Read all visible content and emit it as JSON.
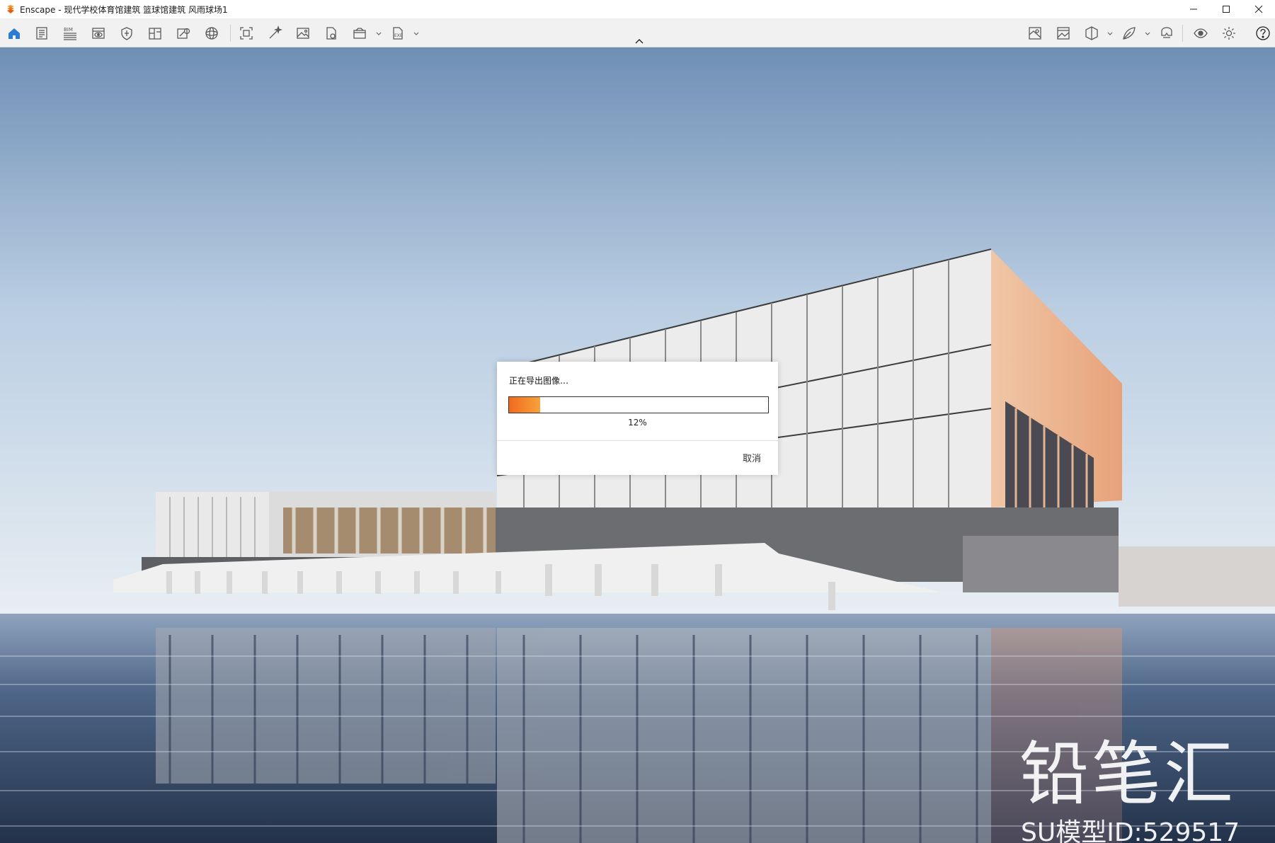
{
  "window": {
    "title": "Enscape - 现代学校体育馆建筑 篮球馆建筑 风雨球场1",
    "controls": [
      "minimize-icon",
      "maximize-icon",
      "close-icon"
    ]
  },
  "toolbar": {
    "left_icons": [
      "home-icon",
      "document-icon",
      "bim-icon",
      "view-icon",
      "shield-icon",
      "floorplan-icon",
      "image-settings-icon",
      "sphere-icon",
      "screenshot-icon",
      "magic-wand-icon",
      "image-icon",
      "export-file-icon",
      "batch-render-icon",
      "exe-export-icon"
    ],
    "right_icons": [
      "map-icon",
      "gallery-icon",
      "cube-icon",
      "leaf-icon",
      "vr-headset-icon",
      "eye-icon",
      "settings-icon",
      "help-icon"
    ],
    "collapse_icon": "chevron-up-icon",
    "colors": {
      "home_active": "#2b7cd3",
      "icon_stroke": "#5a5a5a"
    }
  },
  "dialog": {
    "title": "正在导出图像…",
    "progress": 0.12,
    "progress_text": "12%",
    "cancel_label": "取消",
    "colors": {
      "fill_start": "#f26a1f",
      "fill_end": "#f7a23a"
    }
  },
  "overlay": {
    "brand": "铅笔汇",
    "model_id": "SU模型ID:529517"
  }
}
